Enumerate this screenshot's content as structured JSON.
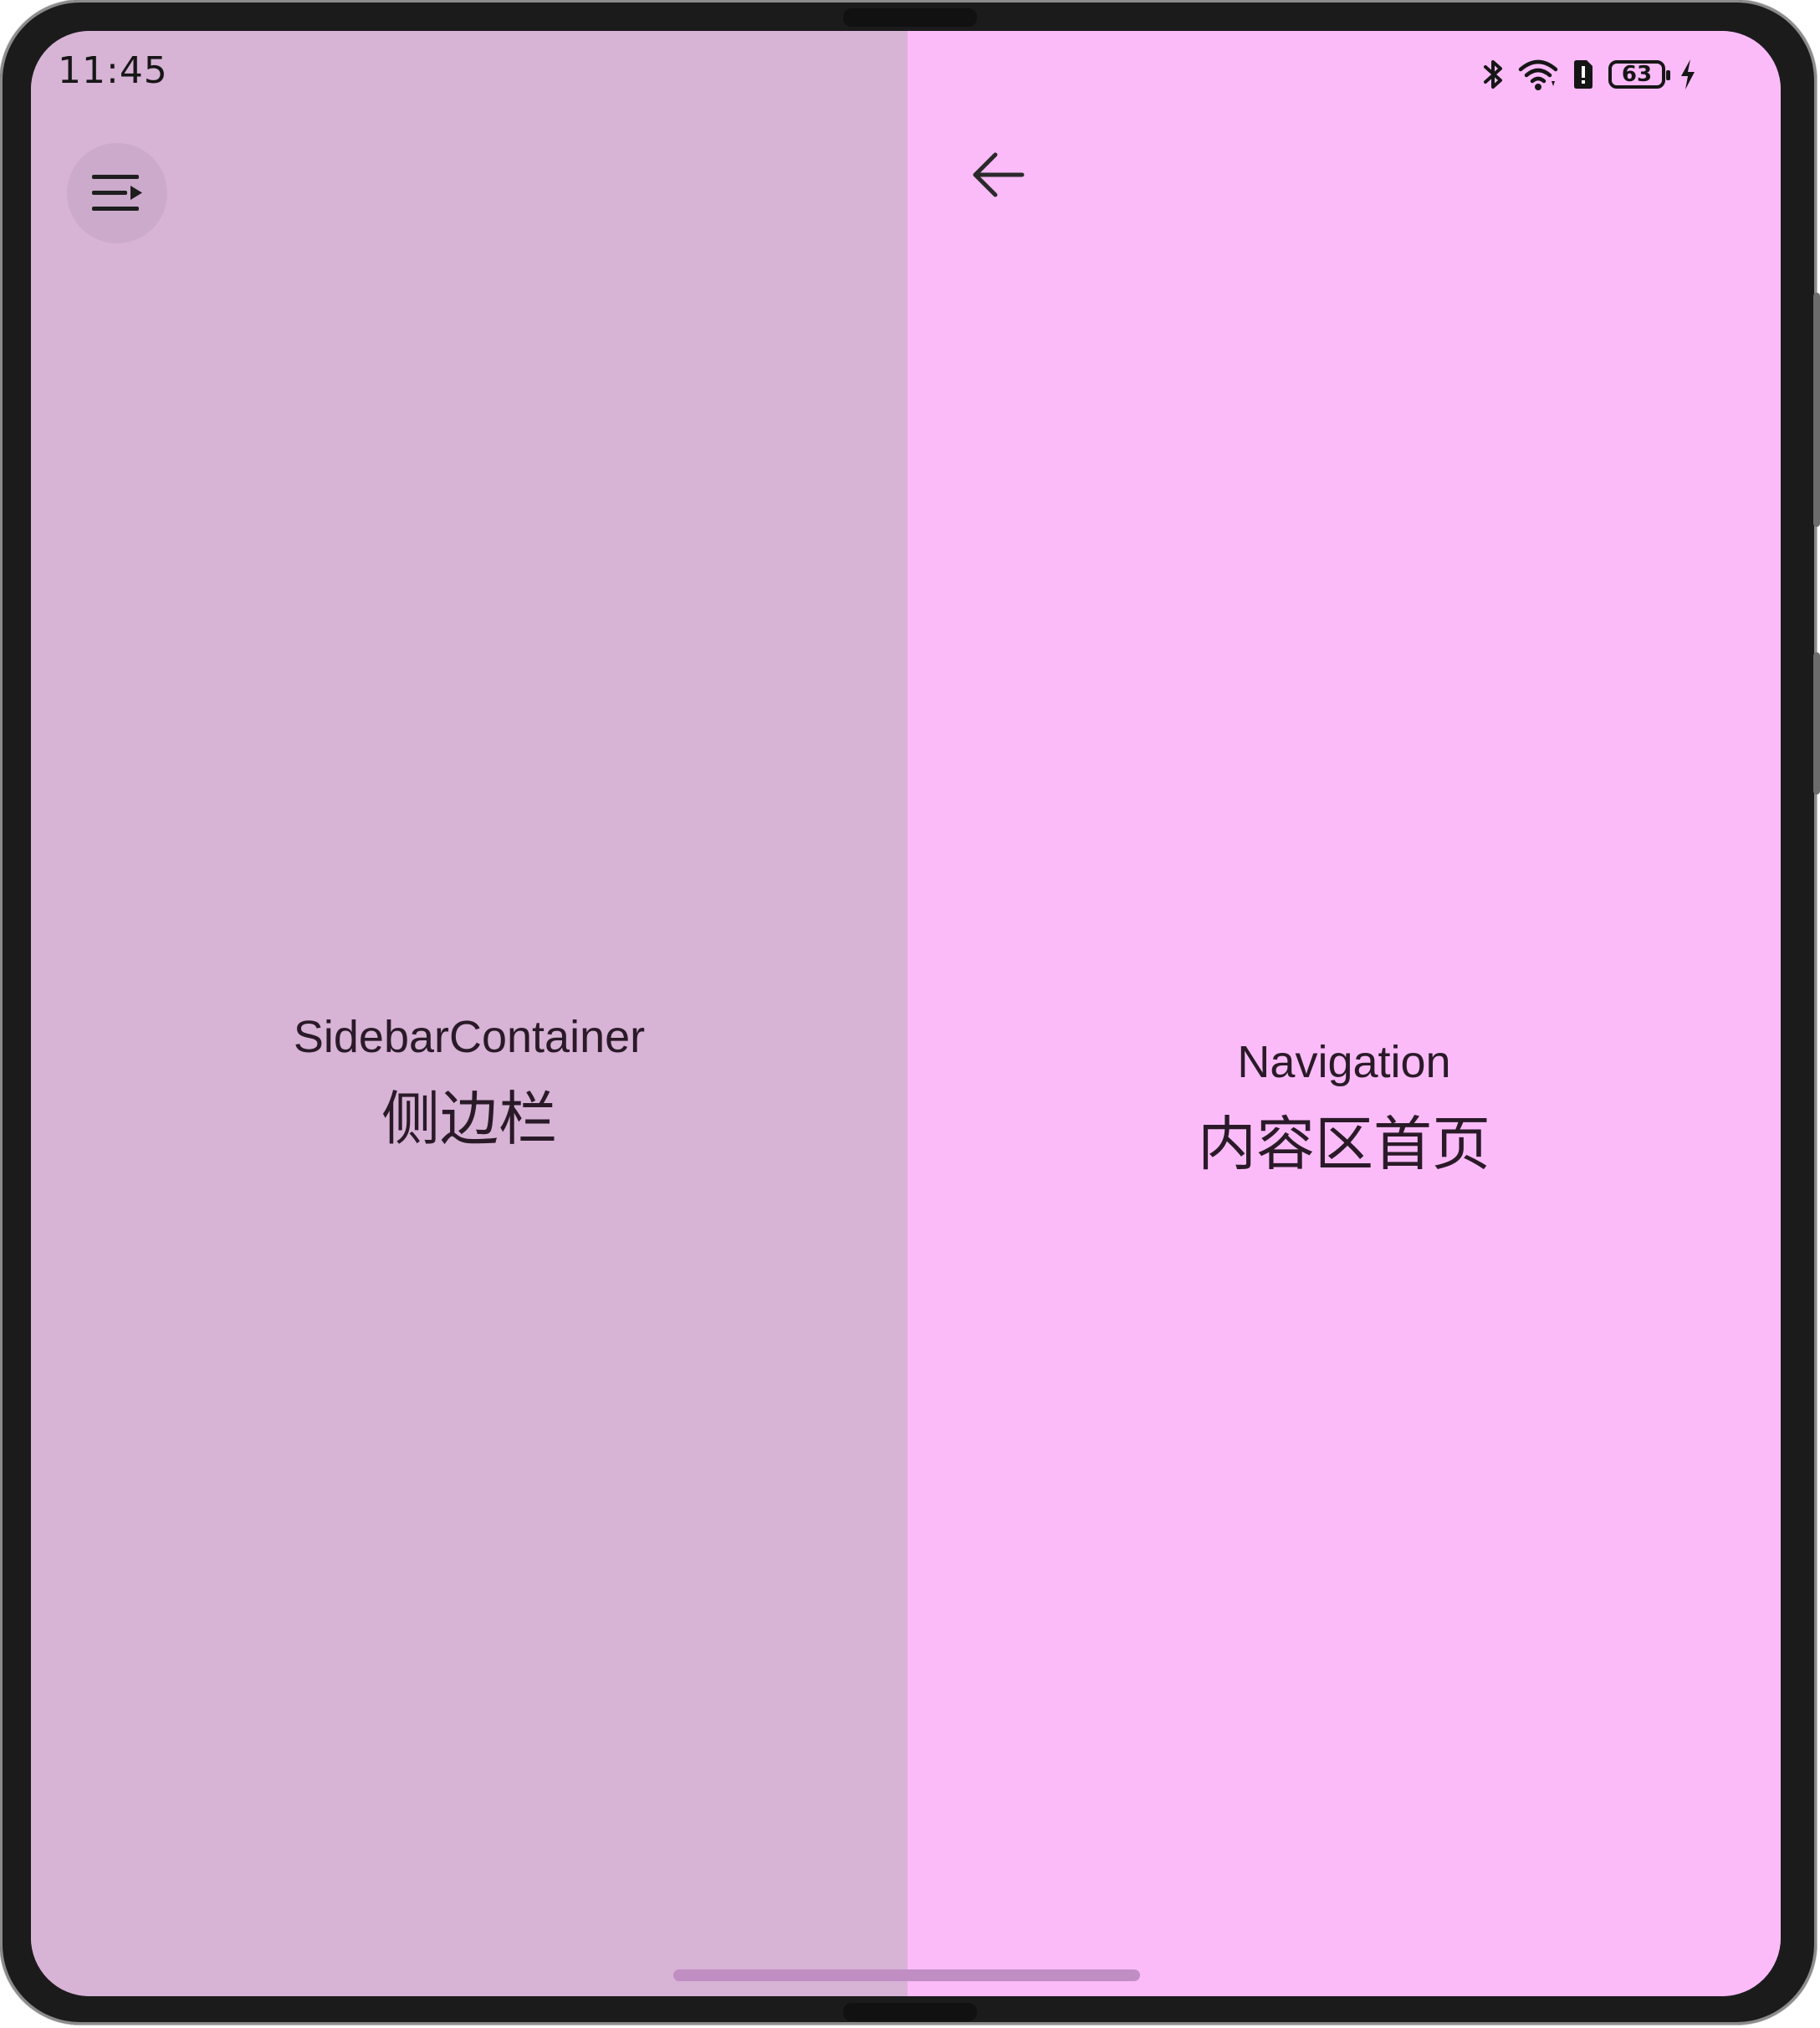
{
  "status_bar": {
    "time": "11:45",
    "battery_level": "63",
    "icons": [
      "bluetooth-icon",
      "wifi-icon",
      "sim-alert-icon",
      "battery-icon",
      "charging-icon"
    ]
  },
  "sidebar": {
    "title": "SidebarContainer",
    "subtitle": "侧边栏",
    "toggle_icon": "sidebar-toggle-icon",
    "background": "#d7b3d5"
  },
  "content": {
    "title": "Navigation",
    "subtitle": "内容区首页",
    "back_icon": "back-arrow-icon",
    "background": "#fabbf8"
  }
}
